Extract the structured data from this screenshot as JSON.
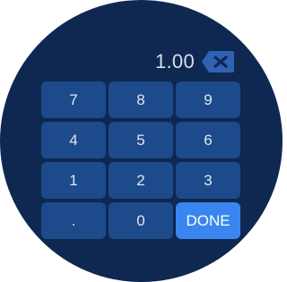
{
  "display": {
    "value": "1.00",
    "backspace_icon": "backspace-icon"
  },
  "keypad": {
    "keys": [
      "7",
      "8",
      "9",
      "4",
      "5",
      "6",
      "1",
      "2",
      "3",
      ".",
      "0",
      "DONE"
    ]
  },
  "colors": {
    "background": "#0e2852",
    "key": "#1d4a8a",
    "done": "#3a86f0",
    "text": "#dfe7f2"
  }
}
